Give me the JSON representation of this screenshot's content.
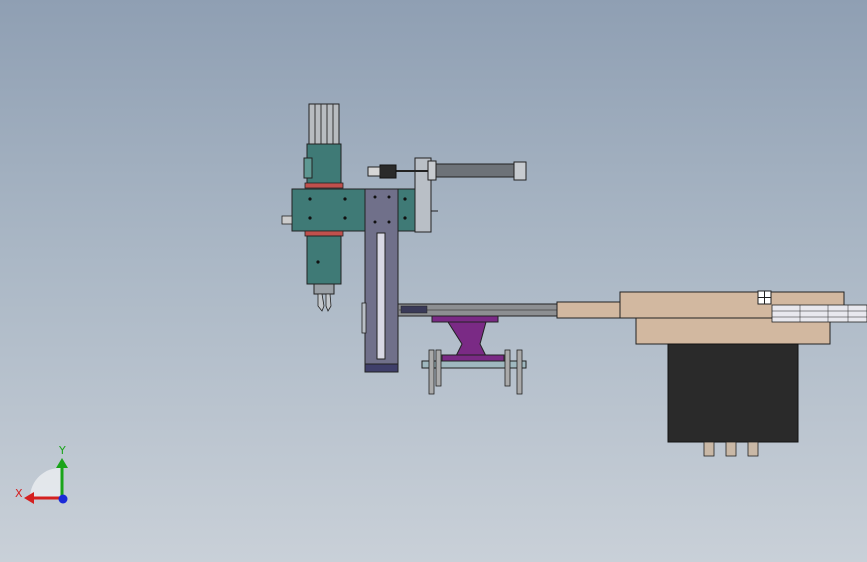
{
  "viewport": {
    "background_top": "#8f9fb3",
    "background_bottom": "#c9d0d8"
  },
  "model": {
    "colors": {
      "teal_body": "#3f7a76",
      "teal_dark": "#2c5b58",
      "slide_plate": "#70708a",
      "slide_dark": "#45455e",
      "purple_part": "#7a2a85",
      "bowl_tan": "#d2b8a0",
      "bowl_tan_dark": "#b39a84",
      "bowl_body": "#2a2a2a",
      "steel": "#9aa0a6",
      "outline": "#222222",
      "accent_red": "#c0504d"
    }
  },
  "triad": {
    "x_label": "X",
    "y_label": "Y",
    "x_color": "#d42020",
    "y_color": "#1aa41a",
    "z_color": "#1a2ad8"
  }
}
